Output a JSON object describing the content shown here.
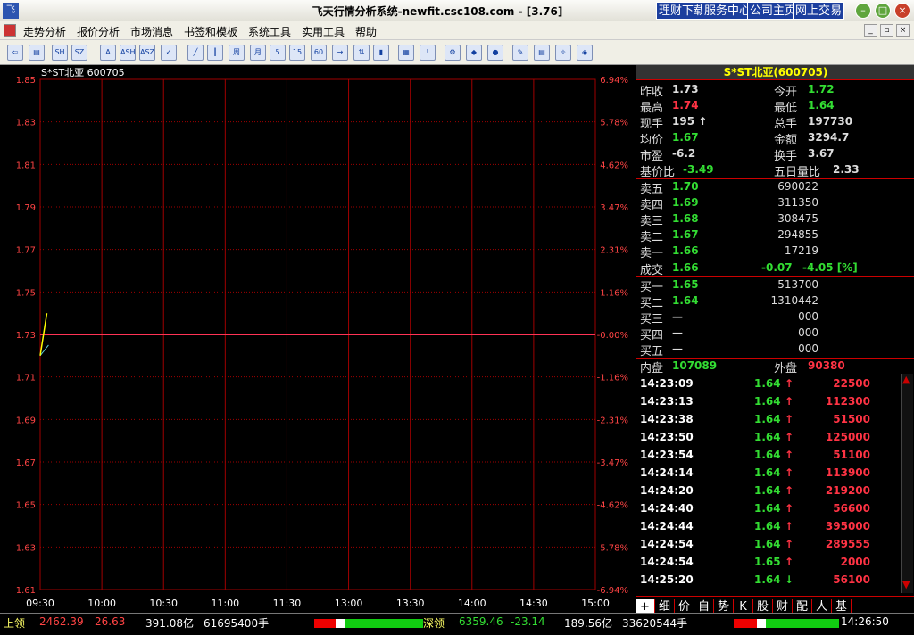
{
  "window": {
    "title": "飞天行情分析系统-newfit.csc108.com - [3.76]",
    "quicklinks": [
      "理财下载",
      "服务中心",
      "公司主页",
      "网上交易"
    ]
  },
  "menu": [
    "走势分析",
    "报价分析",
    "市场消息",
    "书签和模板",
    "系统工具",
    "实用工具",
    "帮助"
  ],
  "chart": {
    "stock_label": "S*ST北亚 600705",
    "prev_close": 1.73,
    "y_left": [
      "1.85",
      "1.83",
      "1.81",
      "1.79",
      "1.77",
      "1.75",
      "1.73",
      "1.71",
      "1.69",
      "1.67",
      "1.65",
      "1.63",
      "1.61"
    ],
    "y_right": [
      "6.94%",
      "5.78%",
      "4.62%",
      "3.47%",
      "2.31%",
      "1.16%",
      "-0.00%",
      "-1.16%",
      "-2.31%",
      "-3.47%",
      "-4.62%",
      "-5.78%",
      "-6.94%"
    ],
    "x_labels": [
      "09:30",
      "10:00",
      "10:30",
      "11:00",
      "11:30",
      "13:00",
      "13:30",
      "14:00",
      "14:30",
      "15:00"
    ],
    "colors": {
      "price": "#ffff00",
      "avg": "#5fd0d8",
      "prev": "#ff3355",
      "grid": "#a00000"
    }
  },
  "chart_data": {
    "type": "line",
    "xlabel": "",
    "ylabel": "",
    "ylim": [
      1.61,
      1.85
    ],
    "x_domain": [
      "09:30",
      "15:00"
    ],
    "grid": true,
    "series": [
      {
        "name": "",
        "points": [
          [
            "09:30",
            1.72
          ],
          [
            "09:34",
            1.74
          ]
        ]
      },
      {
        "name": "",
        "points": [
          [
            "09:30",
            1.72
          ],
          [
            "09:35",
            1.725
          ]
        ]
      }
    ],
    "reference_line": 1.73
  },
  "info": {
    "title": "S*ST北亚(600705)",
    "quote_rows": [
      {
        "l1": "昨收",
        "v1": "1.73",
        "c1": "#dddddd",
        "l2": "今开",
        "v2": "1.72",
        "c2": "#33dd33"
      },
      {
        "l1": "最高",
        "v1": "1.74",
        "c1": "#ff3344",
        "l2": "最低",
        "v2": "1.64",
        "c2": "#33dd33"
      },
      {
        "l1": "现手",
        "v1": "195 ↑",
        "c1": "#dddddd",
        "l2": "总手",
        "v2": "197730",
        "c2": "#dddddd"
      },
      {
        "l1": "均价",
        "v1": "1.67",
        "c1": "#33dd33",
        "l2": "金额",
        "v2": "3294.7",
        "c2": "#dddddd"
      },
      {
        "l1": "市盈",
        "v1": "-6.2",
        "c1": "#dddddd",
        "l2": "换手",
        "v2": "3.67",
        "c2": "#dddddd"
      },
      {
        "l1": "基价比",
        "v1": "-3.49",
        "c1": "#33dd33",
        "l2": "五日量比",
        "v2": "2.33",
        "c2": "#dddddd"
      }
    ],
    "sell": [
      {
        "l": "卖五",
        "p": "1.70",
        "v": "690022"
      },
      {
        "l": "卖四",
        "p": "1.69",
        "v": "311350"
      },
      {
        "l": "卖三",
        "p": "1.68",
        "v": "308475"
      },
      {
        "l": "卖二",
        "p": "1.67",
        "v": "294855"
      },
      {
        "l": "卖一",
        "p": "1.66",
        "v": "17219"
      }
    ],
    "deal": {
      "l": "成交",
      "p": "1.66",
      "chg": "-0.07",
      "pct": "-4.05 [%]"
    },
    "buy": [
      {
        "l": "买一",
        "p": "1.65",
        "v": "513700"
      },
      {
        "l": "买二",
        "p": "1.64",
        "v": "1310442"
      },
      {
        "l": "买三",
        "p": "—",
        "v": "000"
      },
      {
        "l": "买四",
        "p": "—",
        "v": "000"
      },
      {
        "l": "买五",
        "p": "—",
        "v": "000"
      }
    ],
    "inner": {
      "l": "内盘",
      "v": "107089"
    },
    "outer": {
      "l": "外盘",
      "v": "90380"
    },
    "ticks": [
      {
        "t": "14:23:09",
        "p": "1.64",
        "d": "↑",
        "v": "22500"
      },
      {
        "t": "14:23:13",
        "p": "1.64",
        "d": "↑",
        "v": "112300"
      },
      {
        "t": "14:23:38",
        "p": "1.64",
        "d": "↑",
        "v": "51500"
      },
      {
        "t": "14:23:50",
        "p": "1.64",
        "d": "↑",
        "v": "125000"
      },
      {
        "t": "14:23:54",
        "p": "1.64",
        "d": "↑",
        "v": "51100"
      },
      {
        "t": "14:24:14",
        "p": "1.64",
        "d": "↑",
        "v": "113900"
      },
      {
        "t": "14:24:20",
        "p": "1.64",
        "d": "↑",
        "v": "219200"
      },
      {
        "t": "14:24:40",
        "p": "1.64",
        "d": "↑",
        "v": "56600"
      },
      {
        "t": "14:24:44",
        "p": "1.64",
        "d": "↑",
        "v": "395000"
      },
      {
        "t": "14:24:54",
        "p": "1.64",
        "d": "↑",
        "v": "289555"
      },
      {
        "t": "14:24:54",
        "p": "1.65",
        "d": "↑",
        "v": "2000"
      },
      {
        "t": "14:25:20",
        "p": "1.64",
        "d": "↓",
        "v": "56100"
      }
    ],
    "tabs": [
      "+",
      "细",
      "价",
      "自",
      "势",
      "K",
      "股",
      "财",
      "配",
      "人",
      "基"
    ]
  },
  "status": {
    "sh_label": "上领",
    "sh_index": "2462.39",
    "sh_chg": "26.63",
    "sh_amount": "391.08亿",
    "sh_vol": "61695400手",
    "sz_label": "深领",
    "sz_index": "6359.46",
    "sz_chg": "-23.14",
    "sz_amount": "189.56亿",
    "sz_vol": "33620544手",
    "time": "14:26:50"
  }
}
